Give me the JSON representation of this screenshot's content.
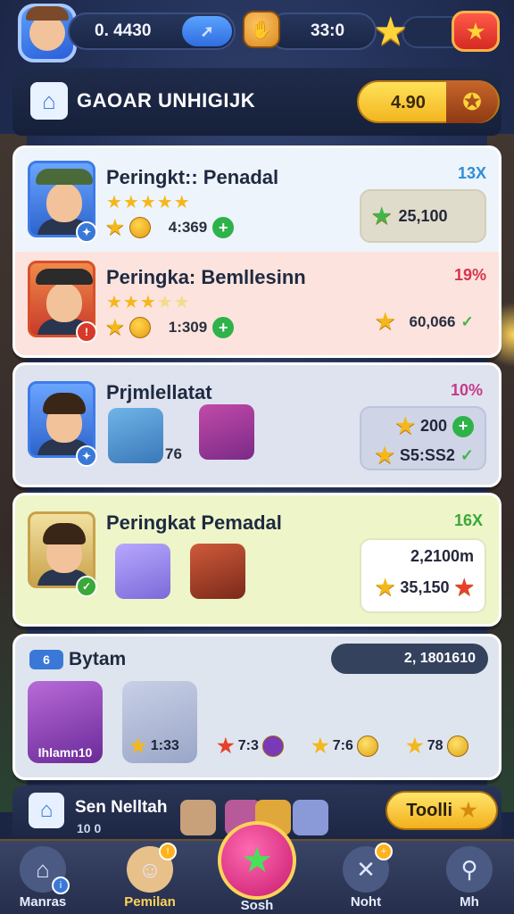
{
  "top_bar": {
    "gems_value": "0. 4430",
    "gems_add_icon": "arrow-icon",
    "coins_value": "33:0",
    "star_icon": "star-icon",
    "red_button_icon": "star-icon"
  },
  "header": {
    "title": "GAOAR UNHIGIJK",
    "pill_value": "4.90"
  },
  "cards": [
    {
      "rows": [
        {
          "title": "Peringkt:: Penadal",
          "stars": 5,
          "stars_filled": 5,
          "sub_value": "4:369",
          "percent": "13X",
          "reward": "25,100",
          "percent_color": "#2f8fd8"
        },
        {
          "title": "Peringka: Bemllesinn",
          "stars": 5,
          "stars_filled": 3,
          "sub_value": "1:309",
          "percent": "19%",
          "reward": "60,066",
          "percent_color": "#d8344a"
        }
      ]
    },
    {
      "title": "Prjmlellatat",
      "item_value": "76",
      "percent": "10%",
      "percent_color": "#c43b8a",
      "reward_top": "200",
      "reward_bottom": "S5:SS2"
    },
    {
      "title": "Peringkat Pemadal",
      "percent": "16X",
      "percent_color": "#3aa83a",
      "reward_top": "2,2100m",
      "reward_bottom": "35,150"
    },
    {
      "tag": "6",
      "title": "Bytam",
      "pill_value": "2, 1801610",
      "heroes": [
        {
          "label": "Ihlamn10"
        },
        {
          "label": "1:33"
        },
        {
          "label": "7:3"
        },
        {
          "label": "7:6"
        },
        {
          "label": "78"
        }
      ]
    }
  ],
  "bottom_strip": {
    "name": "Sen Nelltah",
    "sub": "10 0",
    "button_label": "Toolli"
  },
  "nav": [
    {
      "label": "Manras",
      "icon": "home-icon"
    },
    {
      "label": "Pemilan",
      "icon": "character-icon"
    },
    {
      "label": "Sosh",
      "icon": "star-icon"
    },
    {
      "label": "Noht",
      "icon": "close-icon"
    },
    {
      "label": "Mh",
      "icon": "search-icon"
    }
  ]
}
